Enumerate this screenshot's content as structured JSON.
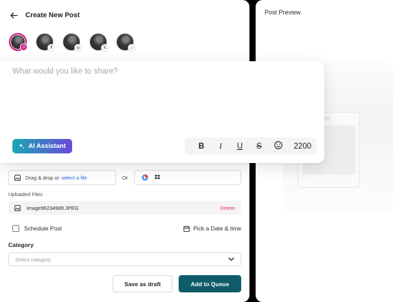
{
  "header": {
    "title": "Create New Post"
  },
  "accounts": [
    {
      "platform": "instagram",
      "badge": "◎",
      "selected": true
    },
    {
      "platform": "facebook",
      "badge": "f",
      "selected": false
    },
    {
      "platform": "instagram",
      "badge": "◎",
      "selected": false
    },
    {
      "platform": "x",
      "badge": "𝕏",
      "selected": false
    },
    {
      "platform": "tiktok",
      "badge": "♪",
      "selected": false
    }
  ],
  "composer": {
    "placeholder": "What would you like to share?",
    "ai_label": "AI Assistant",
    "char_count": "2200",
    "tools": [
      "B",
      "I",
      "U",
      "S"
    ]
  },
  "upload": {
    "drop_text": "Drag & drop or",
    "drop_link": "select a file",
    "or_text": "Or"
  },
  "uploaded": {
    "label": "Uploaded Files",
    "files": [
      {
        "name": "image96234989.JPEG",
        "action": "Delete"
      }
    ]
  },
  "schedule": {
    "label": "Schedule Post",
    "pick_label": "Pick a Date & time",
    "checked": false
  },
  "category": {
    "label": "Category",
    "placeholder": "Select category"
  },
  "actions": {
    "draft_label": "Save as draft",
    "queue_label": "Add to Queue"
  },
  "preview": {
    "title": "Post Preview"
  },
  "colors": {
    "accent": "#0e5c6a",
    "selected_ring": "#d3127f",
    "link": "#2168d8",
    "danger": "#e0394a",
    "ai_gradient_start": "#19a7b4",
    "ai_gradient_end": "#6a49d9"
  }
}
